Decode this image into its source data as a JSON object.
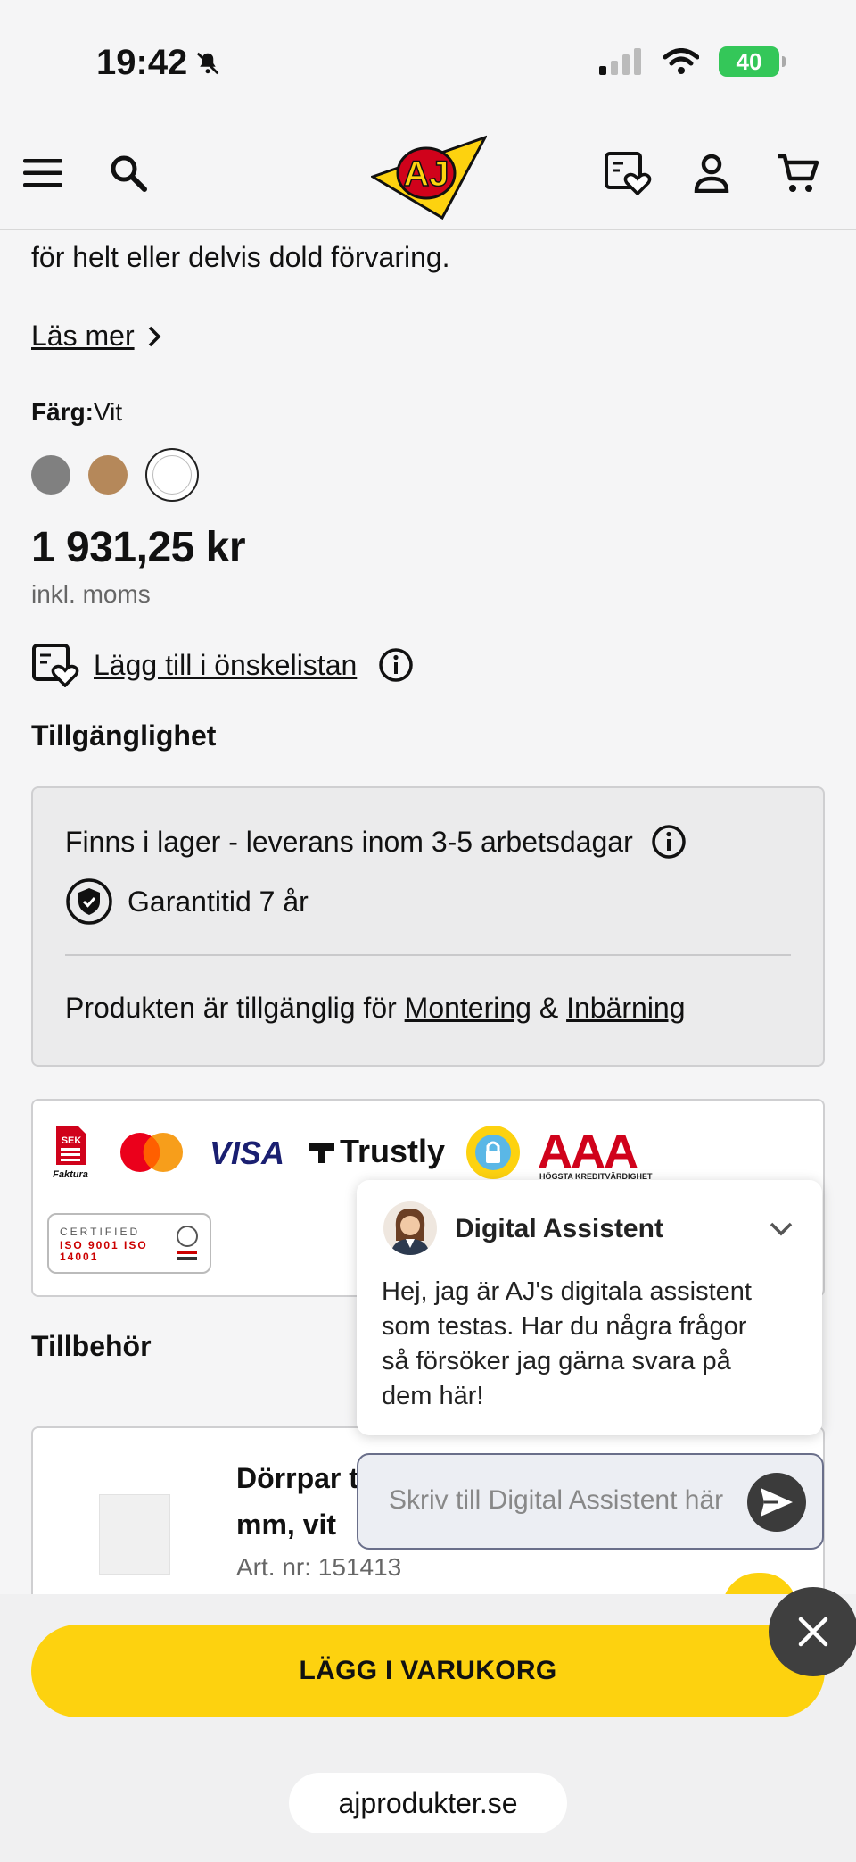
{
  "status_bar": {
    "time": "19:42",
    "battery": "40"
  },
  "header": {
    "logo_text": "AJ"
  },
  "product": {
    "description_tail": "för helt eller delvis dold förvaring.",
    "read_more": "Läs mer",
    "color_label": "Färg:",
    "color_value": "Vit",
    "swatches": [
      {
        "name": "grey",
        "color": "#808080"
      },
      {
        "name": "oak",
        "color": "#b5885a"
      },
      {
        "name": "white",
        "color": "#ffffff",
        "selected": true
      }
    ],
    "price": "1 931,25 kr",
    "vat_note": "inkl. moms",
    "wishlist_label": "Lägg till i önskelistan"
  },
  "availability": {
    "title": "Tillgänglighet",
    "stock": "Finns i lager - leverans inom 3-5 arbetsdagar",
    "warranty": "Garantitid 7 år",
    "services_prefix": "Produkten är tillgänglig för",
    "service_1": "Montering",
    "amp": "&",
    "service_2": "Inbärning"
  },
  "payment": {
    "faktura_top": "SEK",
    "faktura_bottom": "Faktura",
    "visa": "VISA",
    "trustly": "Trustly",
    "trygg": "TRYGG E-HANDEL",
    "aaa": "AAA",
    "aaa_sub": "HÖGSTA KREDITVÄRDIGHET",
    "iso_certified": "CERTIFIED",
    "iso_lines": "ISO 9001 ISO 14001"
  },
  "accessories": {
    "title": "Tillbehör",
    "item_name": "Dörrpar t mm, vit",
    "item_art": "Art. nr: 151413"
  },
  "chat": {
    "title": "Digital Assistent",
    "message": "Hej, jag är AJ's digitala assistent som testas. Har du några frågor så försöker jag gärna svara på dem här!",
    "input_placeholder": "Skriv till Digital Assistent här"
  },
  "cta": {
    "label": "LÄGG I VARUKORG"
  },
  "browser": {
    "url": "ajprodukter.se"
  },
  "colors": {
    "accent_yellow": "#fdd20f",
    "logo_red": "#d0021b"
  }
}
